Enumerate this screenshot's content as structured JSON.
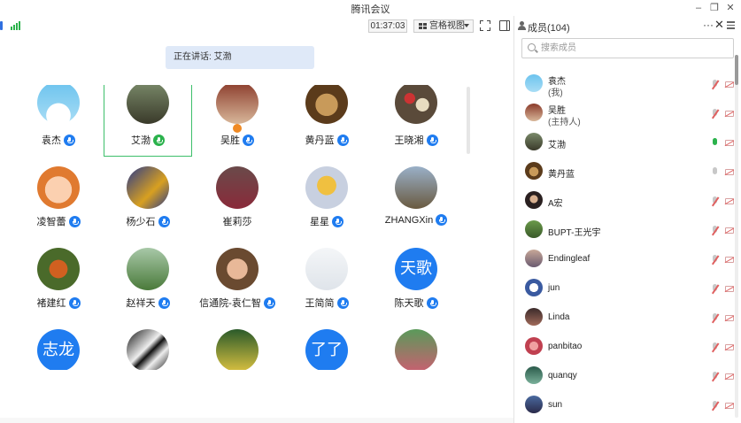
{
  "window": {
    "title": "腾讯会议"
  },
  "toolbar": {
    "timer": "01:37:03",
    "view_label": "宫格视图"
  },
  "speaking": {
    "label": "正在讲话: 艾渤"
  },
  "grid": {
    "participants": [
      {
        "name": "袁杰",
        "mic": "on",
        "avatar": "photo"
      },
      {
        "name": "艾渤",
        "mic": "speaking",
        "avatar": "photo",
        "active": true
      },
      {
        "name": "吴胜",
        "mic": "on",
        "avatar": "photo",
        "host_badge": true
      },
      {
        "name": "黄丹蓝",
        "mic": "on",
        "avatar": "photo"
      },
      {
        "name": "王晓湘",
        "mic": "on",
        "avatar": "photo"
      },
      {
        "name": "凌智蕾",
        "mic": "on",
        "avatar": "photo"
      },
      {
        "name": "杨少石",
        "mic": "on",
        "avatar": "photo"
      },
      {
        "name": "崔莉莎",
        "mic": "none",
        "avatar": "photo"
      },
      {
        "name": "星星",
        "mic": "on",
        "avatar": "photo"
      },
      {
        "name": "ZHANGXin",
        "mic": "on",
        "avatar": "photo"
      },
      {
        "name": "褚建红",
        "mic": "on",
        "avatar": "photo"
      },
      {
        "name": "赵祥天",
        "mic": "on",
        "avatar": "photo"
      },
      {
        "name": "信通院-袁仁智",
        "mic": "on",
        "avatar": "photo"
      },
      {
        "name": "王简简",
        "mic": "on",
        "avatar": "photo"
      },
      {
        "name": "陈天歌",
        "mic": "on",
        "avatar": "text",
        "avatar_text": "天歌"
      },
      {
        "name": "",
        "mic": "none",
        "avatar": "text",
        "avatar_text": "志龙"
      },
      {
        "name": "",
        "mic": "none",
        "avatar": "photo"
      },
      {
        "name": "",
        "mic": "none",
        "avatar": "photo"
      },
      {
        "name": "",
        "mic": "none",
        "avatar": "text",
        "avatar_text": "了了"
      },
      {
        "name": "",
        "mic": "none",
        "avatar": "photo"
      }
    ]
  },
  "members_panel": {
    "title": "成员(104)",
    "search_placeholder": "搜索成员",
    "members": [
      {
        "name": "袁杰",
        "role": "(我)",
        "mic": "muted"
      },
      {
        "name": "吴胜",
        "role": "(主持人)",
        "mic": "muted"
      },
      {
        "name": "艾渤",
        "role": "",
        "mic": "speaking"
      },
      {
        "name": "黄丹蓝",
        "role": "",
        "mic": "on"
      },
      {
        "name": "A宏",
        "role": "",
        "mic": "muted"
      },
      {
        "name": "BUPT-王光宇",
        "role": "",
        "mic": "muted"
      },
      {
        "name": "Endingleaf",
        "role": "",
        "mic": "muted"
      },
      {
        "name": "jun",
        "role": "",
        "mic": "muted"
      },
      {
        "name": "Linda",
        "role": "",
        "mic": "muted"
      },
      {
        "name": "panbitao",
        "role": "",
        "mic": "muted"
      },
      {
        "name": "quanqy",
        "role": "",
        "mic": "muted"
      },
      {
        "name": "sun",
        "role": "",
        "mic": "muted"
      }
    ]
  },
  "colors": {
    "accent": "#1f7cf0",
    "speaking": "#2bb24c",
    "muted": "#e06060",
    "banner": "#dfe9f8"
  }
}
